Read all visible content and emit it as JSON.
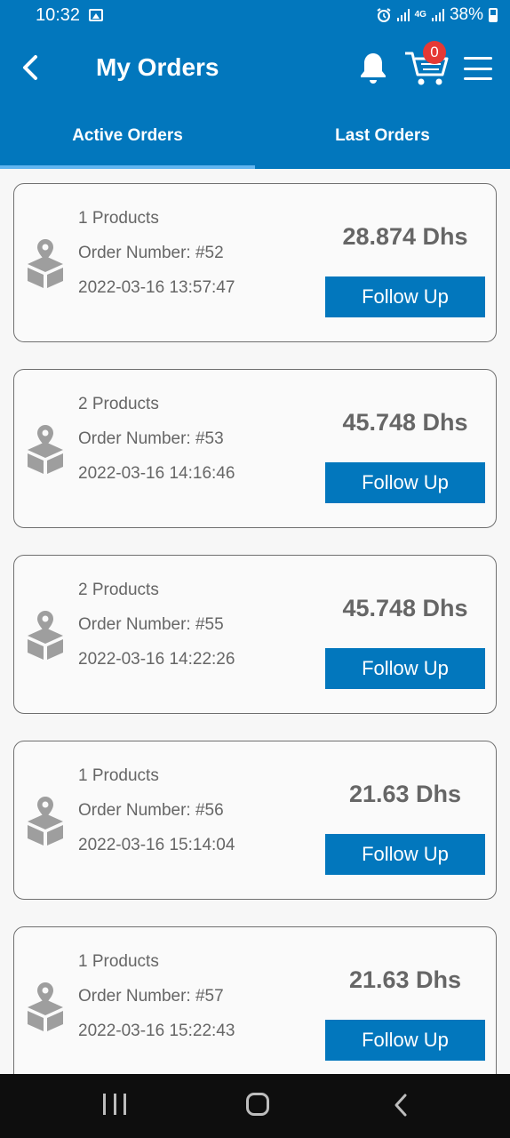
{
  "status_bar": {
    "time": "10:32",
    "network": "4G",
    "battery": "38%",
    "icons": [
      "image-icon",
      "alarm-icon",
      "signal-icon",
      "signal-4g-icon",
      "battery-icon"
    ]
  },
  "header": {
    "title": "My Orders",
    "cart_count": "0",
    "icons": [
      "back-arrow-icon",
      "bell-icon",
      "cart-icon",
      "hamburger-menu-icon"
    ]
  },
  "tabs": [
    {
      "label": "Active Orders",
      "active": true
    },
    {
      "label": "Last Orders",
      "active": false
    }
  ],
  "orders": [
    {
      "products": "1  Products",
      "order_number": "Order Number: #52",
      "datetime": "2022-03-16 13:57:47",
      "price": "28.874 Dhs",
      "action": "Follow Up"
    },
    {
      "products": "2  Products",
      "order_number": "Order Number: #53",
      "datetime": "2022-03-16 14:16:46",
      "price": "45.748 Dhs",
      "action": "Follow Up"
    },
    {
      "products": "2  Products",
      "order_number": "Order Number: #55",
      "datetime": "2022-03-16 14:22:26",
      "price": "45.748 Dhs",
      "action": "Follow Up"
    },
    {
      "products": "1  Products",
      "order_number": "Order Number: #56",
      "datetime": "2022-03-16 15:14:04",
      "price": "21.63 Dhs",
      "action": "Follow Up"
    },
    {
      "products": "1  Products",
      "order_number": "Order Number: #57",
      "datetime": "2022-03-16 15:22:43",
      "price": "21.63 Dhs",
      "action": "Follow Up"
    }
  ],
  "colors": {
    "primary": "#0277bd",
    "badge": "#e53935",
    "text_muted": "#666666"
  },
  "nav_icons": [
    "recents-icon",
    "home-icon",
    "nav-back-icon"
  ]
}
